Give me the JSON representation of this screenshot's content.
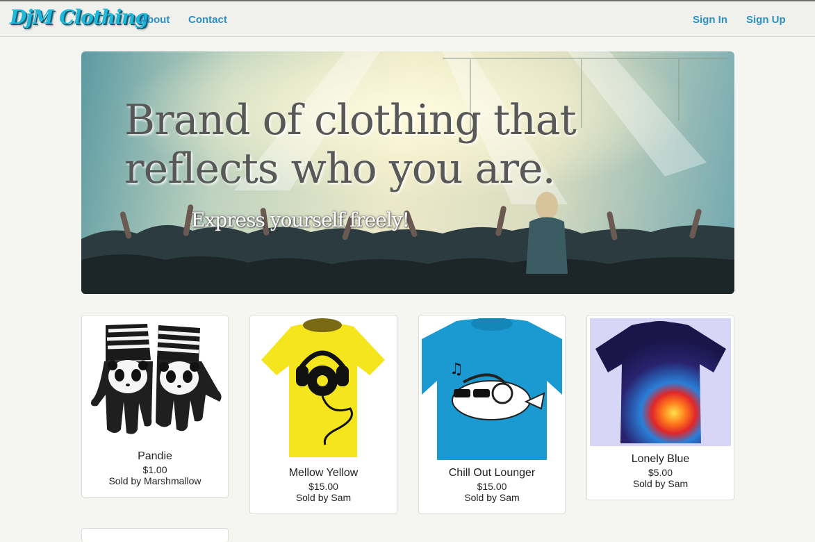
{
  "navbar": {
    "brand": "DjM Clothing",
    "links": [
      {
        "label": "About"
      },
      {
        "label": "Contact"
      }
    ],
    "auth": {
      "sign_in": "Sign In",
      "sign_up": "Sign Up"
    }
  },
  "hero": {
    "title": "Brand of clothing that reflects who you are.",
    "subtitle": "Express yourself freely!"
  },
  "products": [
    {
      "name": "Pandie",
      "price": "$1.00",
      "seller": "Sold by Marshmallow",
      "icon": "panda-gloves-icon"
    },
    {
      "name": "Mellow Yellow",
      "price": "$15.00",
      "seller": "Sold by Sam",
      "icon": "yellow-shirt-icon"
    },
    {
      "name": "Chill Out Lounger",
      "price": "$15.00",
      "seller": "Sold by Sam",
      "icon": "blue-shirt-icon"
    },
    {
      "name": "Lonely Blue",
      "price": "$5.00",
      "seller": "Sold by Sam",
      "icon": "tie-dye-shirt-icon"
    }
  ],
  "colors": {
    "link": "#2a91c4",
    "brand": "#1fb8d8",
    "background": "#f5f5f1"
  }
}
